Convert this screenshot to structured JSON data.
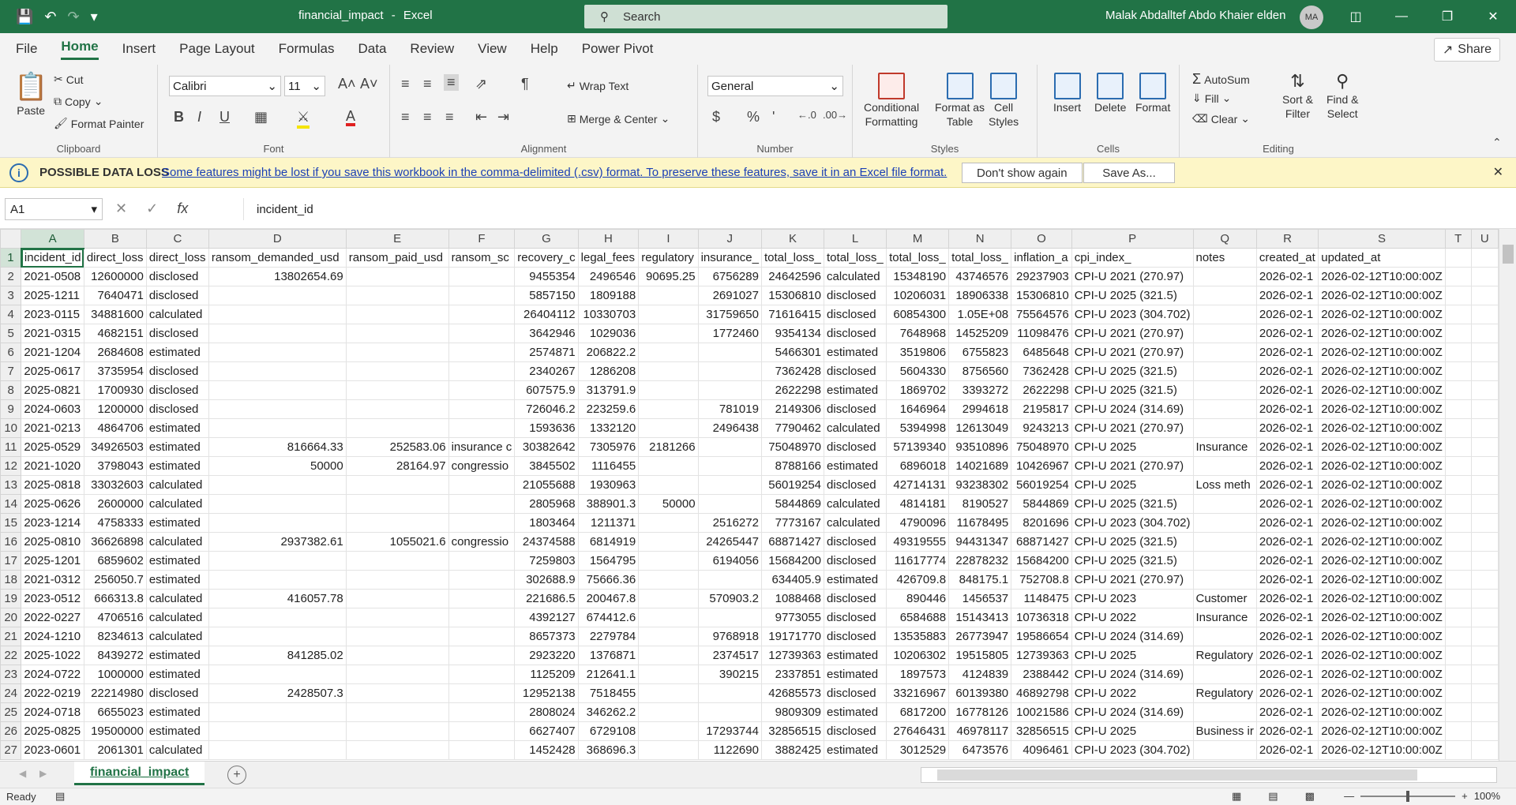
{
  "titlebar": {
    "file_name": "financial_impact",
    "separator": "-",
    "app_name": "Excel",
    "search_placeholder": "Search",
    "user_name": "Malak Abdalltef Abdo Khaier elden",
    "user_initials": "MA"
  },
  "tabs": [
    "File",
    "Home",
    "Insert",
    "Page Layout",
    "Formulas",
    "Data",
    "Review",
    "View",
    "Help",
    "Power Pivot"
  ],
  "share_label": "Share",
  "ribbon": {
    "clipboard": {
      "label": "Clipboard",
      "paste": "Paste",
      "cut": "Cut",
      "copy": "Copy",
      "format_painter": "Format Painter"
    },
    "font": {
      "label": "Font",
      "font_name": "Calibri",
      "font_size": "11"
    },
    "alignment": {
      "label": "Alignment",
      "wrap_text": "Wrap Text",
      "merge_center": "Merge & Center"
    },
    "number": {
      "label": "Number",
      "format": "General"
    },
    "styles": {
      "label": "Styles",
      "conditional": "Conditional",
      "conditional2": "Formatting",
      "format_as": "Format as",
      "format_as2": "Table",
      "cell": "Cell",
      "cell2": "Styles"
    },
    "cells": {
      "label": "Cells",
      "insert": "Insert",
      "delete": "Delete",
      "format": "Format"
    },
    "editing": {
      "label": "Editing",
      "autosum": "AutoSum",
      "fill": "Fill",
      "clear": "Clear",
      "sort": "Sort &",
      "sort2": "Filter",
      "find": "Find &",
      "find2": "Select"
    }
  },
  "message_bar": {
    "title": "POSSIBLE DATA LOSS",
    "text": "Some features might be lost if you save this workbook in the comma-delimited (.csv) format. To preserve these features, save it in an Excel file format.",
    "dont_show": "Don't show again",
    "save_as": "Save As..."
  },
  "formula_bar": {
    "name_box": "A1",
    "content": "incident_id"
  },
  "columns": [
    "A",
    "B",
    "C",
    "D",
    "E",
    "F",
    "G",
    "H",
    "I",
    "J",
    "K",
    "L",
    "M",
    "N",
    "O",
    "P",
    "Q",
    "R",
    "S",
    "T",
    "U"
  ],
  "rows": [
    [
      "incident_id",
      "direct_loss",
      "direct_loss",
      "ransom_demanded_usd",
      "ransom_paid_usd",
      "ransom_sc",
      "recovery_c",
      "legal_fees",
      "regulatory",
      "insurance_",
      "total_loss_",
      "total_loss_",
      "total_loss_",
      "total_loss_",
      "inflation_a",
      "cpi_index_",
      "notes",
      "created_at",
      "updated_at",
      "",
      ""
    ],
    [
      "2021-0508",
      "12600000",
      "disclosed",
      "13802654.69",
      "",
      "",
      "9455354",
      "2496546",
      "90695.25",
      "6756289",
      "24642596",
      "calculated",
      "15348190",
      "43746576",
      "29237903",
      "CPI-U 2021 (270.97)",
      "",
      "2026-02-1",
      "2026-02-12T10:00:00Z",
      "",
      ""
    ],
    [
      "2025-1211",
      "7640471",
      "disclosed",
      "",
      "",
      "",
      "5857150",
      "1809188",
      "",
      "2691027",
      "15306810",
      "disclosed",
      "10206031",
      "18906338",
      "15306810",
      "CPI-U 2025 (321.5)",
      "",
      "2026-02-1",
      "2026-02-12T10:00:00Z",
      "",
      ""
    ],
    [
      "2023-0115",
      "34881600",
      "calculated",
      "",
      "",
      "",
      "26404112",
      "10330703",
      "",
      "31759650",
      "71616415",
      "disclosed",
      "60854300",
      "1.05E+08",
      "75564576",
      "CPI-U 2023 (304.702)",
      "",
      "2026-02-1",
      "2026-02-12T10:00:00Z",
      "",
      ""
    ],
    [
      "2021-0315",
      "4682151",
      "disclosed",
      "",
      "",
      "",
      "3642946",
      "1029036",
      "",
      "1772460",
      "9354134",
      "disclosed",
      "7648968",
      "14525209",
      "11098476",
      "CPI-U 2021 (270.97)",
      "",
      "2026-02-1",
      "2026-02-12T10:00:00Z",
      "",
      ""
    ],
    [
      "2021-1204",
      "2684608",
      "estimated",
      "",
      "",
      "",
      "2574871",
      "206822.2",
      "",
      "",
      "5466301",
      "estimated",
      "3519806",
      "6755823",
      "6485648",
      "CPI-U 2021 (270.97)",
      "",
      "2026-02-1",
      "2026-02-12T10:00:00Z",
      "",
      ""
    ],
    [
      "2025-0617",
      "3735954",
      "disclosed",
      "",
      "",
      "",
      "2340267",
      "1286208",
      "",
      "",
      "7362428",
      "disclosed",
      "5604330",
      "8756560",
      "7362428",
      "CPI-U 2025 (321.5)",
      "",
      "2026-02-1",
      "2026-02-12T10:00:00Z",
      "",
      ""
    ],
    [
      "2025-0821",
      "1700930",
      "disclosed",
      "",
      "",
      "",
      "607575.9",
      "313791.9",
      "",
      "",
      "2622298",
      "estimated",
      "1869702",
      "3393272",
      "2622298",
      "CPI-U 2025 (321.5)",
      "",
      "2026-02-1",
      "2026-02-12T10:00:00Z",
      "",
      ""
    ],
    [
      "2024-0603",
      "1200000",
      "disclosed",
      "",
      "",
      "",
      "726046.2",
      "223259.6",
      "",
      "781019",
      "2149306",
      "disclosed",
      "1646964",
      "2994618",
      "2195817",
      "CPI-U 2024 (314.69)",
      "",
      "2026-02-1",
      "2026-02-12T10:00:00Z",
      "",
      ""
    ],
    [
      "2021-0213",
      "4864706",
      "estimated",
      "",
      "",
      "",
      "1593636",
      "1332120",
      "",
      "2496438",
      "7790462",
      "calculated",
      "5394998",
      "12613049",
      "9243213",
      "CPI-U 2021 (270.97)",
      "",
      "2026-02-1",
      "2026-02-12T10:00:00Z",
      "",
      ""
    ],
    [
      "2025-0529",
      "34926503",
      "estimated",
      "816664.33",
      "252583.06",
      "insurance c",
      "30382642",
      "7305976",
      "2181266",
      "",
      "75048970",
      "disclosed",
      "57139340",
      "93510896",
      "75048970",
      "CPI-U 2025",
      "Insurance",
      "2026-02-1",
      "2026-02-12T10:00:00Z",
      "",
      ""
    ],
    [
      "2021-1020",
      "3798043",
      "estimated",
      "50000",
      "28164.97",
      "congressio",
      "3845502",
      "1116455",
      "",
      "",
      "8788166",
      "estimated",
      "6896018",
      "14021689",
      "10426967",
      "CPI-U 2021 (270.97)",
      "",
      "2026-02-1",
      "2026-02-12T10:00:00Z",
      "",
      ""
    ],
    [
      "2025-0818",
      "33032603",
      "calculated",
      "",
      "",
      "",
      "21055688",
      "1930963",
      "",
      "",
      "56019254",
      "disclosed",
      "42714131",
      "93238302",
      "56019254",
      "CPI-U 2025",
      "Loss meth",
      "2026-02-1",
      "2026-02-12T10:00:00Z",
      "",
      ""
    ],
    [
      "2025-0626",
      "2600000",
      "calculated",
      "",
      "",
      "",
      "2805968",
      "388901.3",
      "50000",
      "",
      "5844869",
      "calculated",
      "4814181",
      "8190527",
      "5844869",
      "CPI-U 2025 (321.5)",
      "",
      "2026-02-1",
      "2026-02-12T10:00:00Z",
      "",
      ""
    ],
    [
      "2023-1214",
      "4758333",
      "estimated",
      "",
      "",
      "",
      "1803464",
      "1211371",
      "",
      "2516272",
      "7773167",
      "calculated",
      "4790096",
      "11678495",
      "8201696",
      "CPI-U 2023 (304.702)",
      "",
      "2026-02-1",
      "2026-02-12T10:00:00Z",
      "",
      ""
    ],
    [
      "2025-0810",
      "36626898",
      "calculated",
      "2937382.61",
      "1055021.6",
      "congressio",
      "24374588",
      "6814919",
      "",
      "24265447",
      "68871427",
      "disclosed",
      "49319555",
      "94431347",
      "68871427",
      "CPI-U 2025 (321.5)",
      "",
      "2026-02-1",
      "2026-02-12T10:00:00Z",
      "",
      ""
    ],
    [
      "2025-1201",
      "6859602",
      "estimated",
      "",
      "",
      "",
      "7259803",
      "1564795",
      "",
      "6194056",
      "15684200",
      "disclosed",
      "11617774",
      "22878232",
      "15684200",
      "CPI-U 2025 (321.5)",
      "",
      "2026-02-1",
      "2026-02-12T10:00:00Z",
      "",
      ""
    ],
    [
      "2021-0312",
      "256050.7",
      "estimated",
      "",
      "",
      "",
      "302688.9",
      "75666.36",
      "",
      "",
      "634405.9",
      "estimated",
      "426709.8",
      "848175.1",
      "752708.8",
      "CPI-U 2021 (270.97)",
      "",
      "2026-02-1",
      "2026-02-12T10:00:00Z",
      "",
      ""
    ],
    [
      "2023-0512",
      "666313.8",
      "calculated",
      "416057.78",
      "",
      "",
      "221686.5",
      "200467.8",
      "",
      "570903.2",
      "1088468",
      "disclosed",
      "890446",
      "1456537",
      "1148475",
      "CPI-U 2023",
      "Customer",
      "2026-02-1",
      "2026-02-12T10:00:00Z",
      "",
      ""
    ],
    [
      "2022-0227",
      "4706516",
      "calculated",
      "",
      "",
      "",
      "4392127",
      "674412.6",
      "",
      "",
      "9773055",
      "disclosed",
      "6584688",
      "15143413",
      "10736318",
      "CPI-U 2022",
      "Insurance",
      "2026-02-1",
      "2026-02-12T10:00:00Z",
      "",
      ""
    ],
    [
      "2024-1210",
      "8234613",
      "calculated",
      "",
      "",
      "",
      "8657373",
      "2279784",
      "",
      "9768918",
      "19171770",
      "disclosed",
      "13535883",
      "26773947",
      "19586654",
      "CPI-U 2024 (314.69)",
      "",
      "2026-02-1",
      "2026-02-12T10:00:00Z",
      "",
      ""
    ],
    [
      "2025-1022",
      "8439272",
      "estimated",
      "841285.02",
      "",
      "",
      "2923220",
      "1376871",
      "",
      "2374517",
      "12739363",
      "estimated",
      "10206302",
      "19515805",
      "12739363",
      "CPI-U 2025",
      "Regulatory",
      "2026-02-1",
      "2026-02-12T10:00:00Z",
      "",
      ""
    ],
    [
      "2024-0722",
      "1000000",
      "estimated",
      "",
      "",
      "",
      "1125209",
      "212641.1",
      "",
      "390215",
      "2337851",
      "estimated",
      "1897573",
      "4124839",
      "2388442",
      "CPI-U 2024 (314.69)",
      "",
      "2026-02-1",
      "2026-02-12T10:00:00Z",
      "",
      ""
    ],
    [
      "2022-0219",
      "22214980",
      "disclosed",
      "2428507.3",
      "",
      "",
      "12952138",
      "7518455",
      "",
      "",
      "42685573",
      "disclosed",
      "33216967",
      "60139380",
      "46892798",
      "CPI-U 2022",
      "Regulatory",
      "2026-02-1",
      "2026-02-12T10:00:00Z",
      "",
      ""
    ],
    [
      "2024-0718",
      "6655023",
      "estimated",
      "",
      "",
      "",
      "2808024",
      "346262.2",
      "",
      "",
      "9809309",
      "estimated",
      "6817200",
      "16778126",
      "10021586",
      "CPI-U 2024 (314.69)",
      "",
      "2026-02-1",
      "2026-02-12T10:00:00Z",
      "",
      ""
    ],
    [
      "2025-0825",
      "19500000",
      "estimated",
      "",
      "",
      "",
      "6627407",
      "6729108",
      "",
      "17293744",
      "32856515",
      "disclosed",
      "27646431",
      "46978117",
      "32856515",
      "CPI-U 2025",
      "Business ir",
      "2026-02-1",
      "2026-02-12T10:00:00Z",
      "",
      ""
    ],
    [
      "2023-0601",
      "2061301",
      "calculated",
      "",
      "",
      "",
      "1452428",
      "368696.3",
      "",
      "1122690",
      "3882425",
      "estimated",
      "3012529",
      "6473576",
      "4096461",
      "CPI-U 2023 (304.702)",
      "",
      "2026-02-1",
      "2026-02-12T10:00:00Z",
      "",
      ""
    ]
  ],
  "sheet_tab": "financial_impact",
  "status": {
    "ready": "Ready",
    "zoom": "100%"
  }
}
